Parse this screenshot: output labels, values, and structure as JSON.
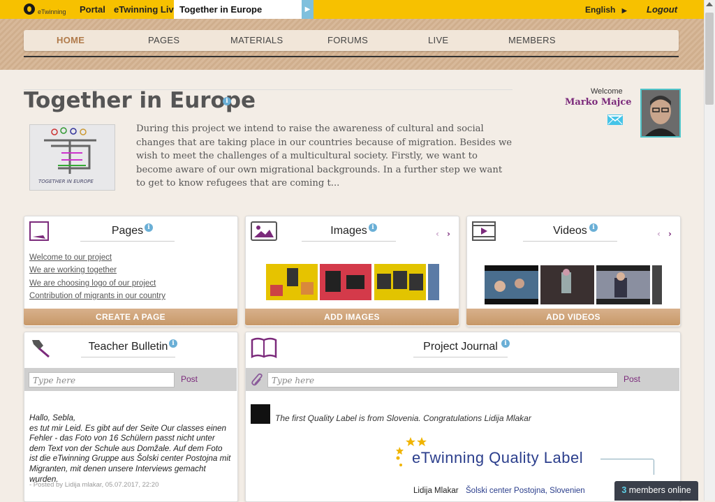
{
  "topbar": {
    "logo_text": "eTwinning",
    "links": [
      "Portal",
      "eTwinning Live"
    ],
    "active_tab": "Together in Europe",
    "tab_arrow": "▶",
    "language": "English",
    "language_arrow": "▶",
    "logout": "Logout"
  },
  "nav": {
    "items": [
      "HOME",
      "PAGES",
      "MATERIALS",
      "FORUMS",
      "LIVE",
      "MEMBERS"
    ],
    "active": "HOME"
  },
  "project": {
    "title": "Together in Europe",
    "info_glyph": "i",
    "description": "During this project we intend to raise the awareness of cultural and social changes that are taking place in our countries because of migration. Besides we wish to meet the challenges of a multicultural society. Firstly, we want to become aware of our own migrational backgrounds. In a further step we want to get to know refugees that are coming t...",
    "image_caption": "TOGETHER IN EUROPE"
  },
  "user": {
    "welcome": "Welcome",
    "name": "Marko Majce"
  },
  "cards": {
    "pages": {
      "title": "Pages",
      "links": [
        "Welcome to our project",
        "We are working together",
        "We are choosing logo of our project",
        "Contribution of migrants in our country"
      ],
      "button": "CREATE A PAGE"
    },
    "images": {
      "title": "Images",
      "prev": "‹",
      "next": "›",
      "button": "ADD IMAGES"
    },
    "videos": {
      "title": "Videos",
      "prev": "‹",
      "next": "›",
      "button": "ADD VIDEOS"
    },
    "bulletin": {
      "title": "Teacher Bulletin",
      "placeholder": "Type here",
      "post_label": "Post",
      "message": "Hallo, Sebla,\nes tut mir Leid. Es gibt auf der Seite Our classes einen Fehler - das Foto von 16 Schülern passt nicht unter dem Text von der Schule aus Domžale. Auf dem Foto ist die eTwinning Gruppe aus Šolski center Postojna mit Migranten, mit denen unsere Interviews gemacht wurden.",
      "meta": "- Posted by Lidija mlakar, 05.07.2017, 22:20"
    },
    "journal": {
      "title": "Project Journal",
      "placeholder": "Type here",
      "post_label": "Post",
      "entry": "The first Quality Label is from Slovenia. Congratulations Lidija Mlakar",
      "label_title": "eTwinning Quality Label",
      "label_author": "Lidija Mlakar",
      "label_school": "Šolski center Postojna, Slovenien"
    }
  },
  "online": {
    "count": "3",
    "text": "members online"
  },
  "colors": {
    "topbar": "#f7c100",
    "accent_purple": "#7b2a7b",
    "button_tan": "#c79868",
    "info_blue": "#6aafd6"
  }
}
